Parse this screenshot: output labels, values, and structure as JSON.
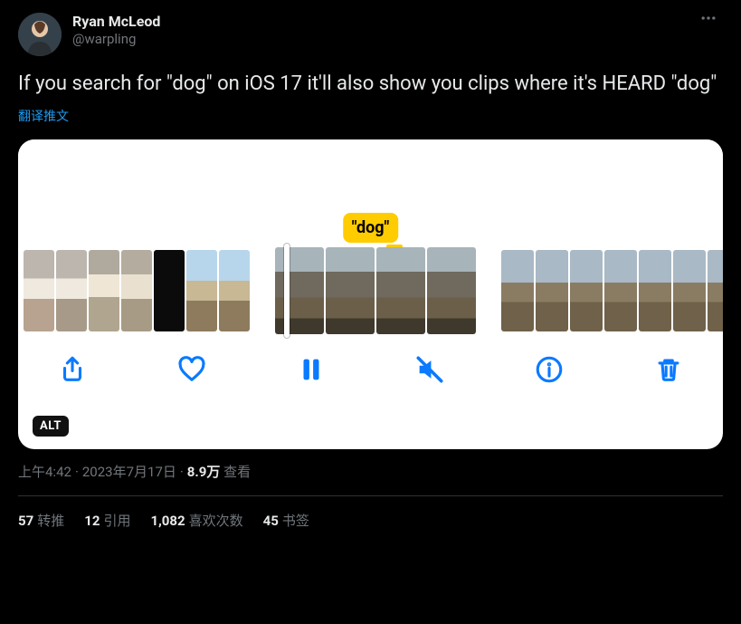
{
  "author": {
    "display_name": "Ryan McLeod",
    "handle": "@warpling"
  },
  "tweet": {
    "text": "If you search for \"dog\" on iOS 17 it'll also show you clips where it's HEARD \"dog\"",
    "translate_label": "翻译推文"
  },
  "media": {
    "alt_label": "ALT",
    "keyword_label": "\"dog\"",
    "toolbar": {
      "share": "share",
      "like": "like",
      "pause": "pause",
      "mute": "mute",
      "info": "info",
      "delete": "delete"
    }
  },
  "meta": {
    "time": "上午4:42",
    "date": "2023年7月17日",
    "views_number": "8.9万",
    "views_label": "查看"
  },
  "stats": {
    "retweets_num": "57",
    "retweets_label": "转推",
    "quotes_num": "12",
    "quotes_label": "引用",
    "likes_num": "1,082",
    "likes_label": "喜欢次数",
    "bookmarks_num": "45",
    "bookmarks_label": "书签"
  }
}
